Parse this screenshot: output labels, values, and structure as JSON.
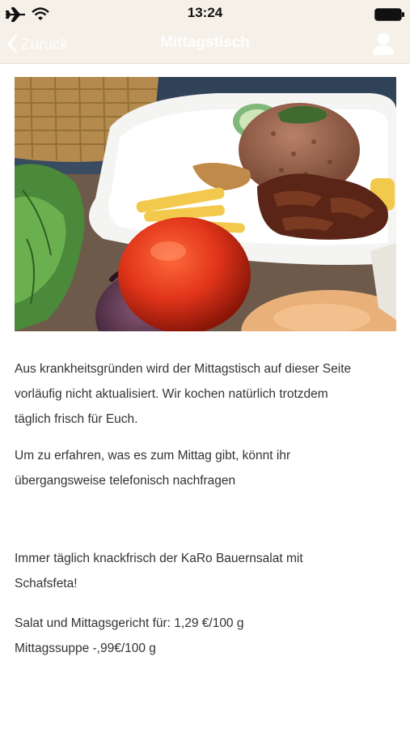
{
  "status_bar": {
    "time": "13:24",
    "icons": [
      "airplane-icon",
      "wifi-icon",
      "battery-icon"
    ]
  },
  "nav": {
    "back_label": "Zurück",
    "title": "Mittagstisch",
    "right_icon": "user-icon"
  },
  "hero_image": {
    "description_icon": "food-photo"
  },
  "content": {
    "p1": [
      "Aus krankheitsgründen wird der Mittagstisch auf dieser Seite",
      "vorläufig nicht aktualisiert. Wir kochen natürlich trotzdem",
      "täglich frisch für Euch."
    ],
    "p2": [
      "Um zu erfahren, was es zum Mittag gibt, könnt ihr",
      "übergangsweise telefonisch nachfragen"
    ],
    "p3": [
      "Immer täglich knackfrisch der KaRo Bauernsalat mit",
      "Schafsfeta!"
    ],
    "p4": [
      "Salat und Mittagsgericht für: 1,29 €/100 g",
      "Mittagssuppe -,99€/100 g"
    ]
  },
  "colors": {
    "bar_bg": "#f6f1e8",
    "text": "#333333"
  }
}
